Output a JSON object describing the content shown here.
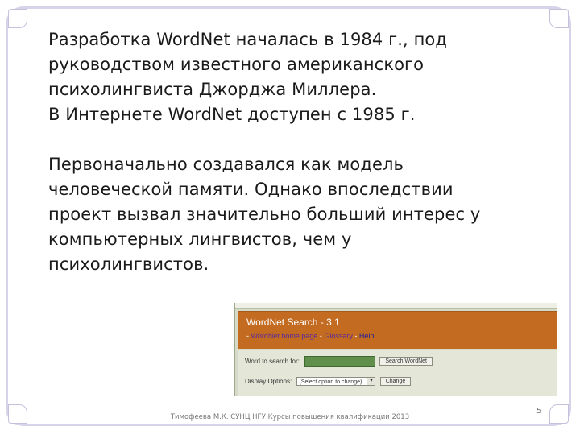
{
  "slide": {
    "paragraph1": [
      "Разработка WordNet началась в 1984 г., под",
      "руководством известного американского",
      "психолингвиста Джорджа Миллера.",
      "В Интернете WordNet доступен с 1985 г."
    ],
    "paragraph2": [
      "Первоначально создавался как модель",
      "человеческой памяти.  Однако впоследствии",
      "проект вызвал значительно больший интерес у",
      "компьютерных лингвистов, чем у",
      "психолингвистов."
    ],
    "footer": "Тимофеева М.К. СУНЦ НГУ Курсы повышения квалификации 2013",
    "page_number": "5"
  },
  "wordnet_screenshot": {
    "title": "WordNet Search - 3.1",
    "links": {
      "prefix": "- ",
      "home": "WordNet home page",
      "sep1": " - ",
      "glossary": "Glossary",
      "sep2": " - ",
      "help": "Help"
    },
    "word_label": "Word to search for:",
    "word_value": "",
    "search_button": "Search WordNet",
    "display_label": "Display Options:",
    "display_select": "(Select option to change)",
    "change_button": "Change"
  },
  "colors": {
    "header_bg": "#c26b21",
    "frame_border": "#d8d3e8",
    "input_bg": "#5f8f4a"
  }
}
